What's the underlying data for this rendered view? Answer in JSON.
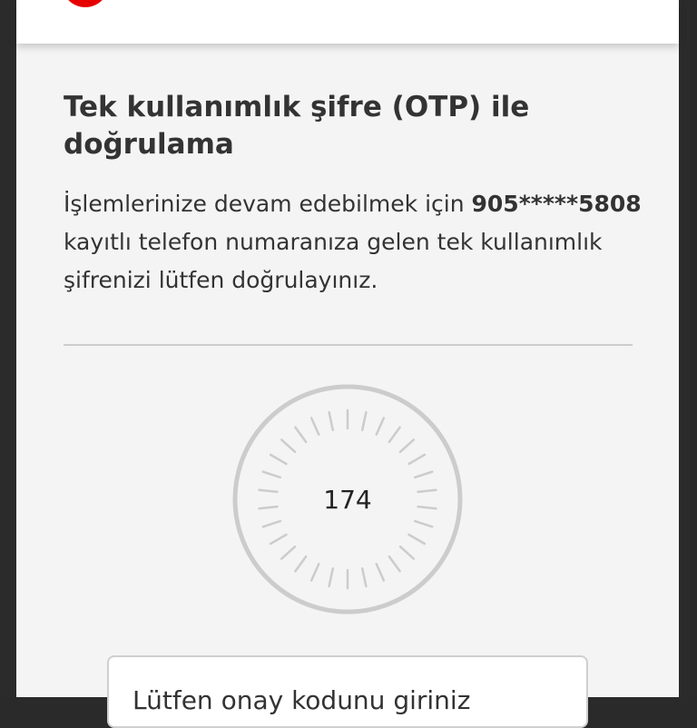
{
  "header": {
    "logo_icon": "vodafone-logo-icon",
    "brand_color": "#e60000"
  },
  "main": {
    "title": "Tek kullanımlık şifre (OTP) ile doğrulama",
    "description_prefix": "İşlemlerinize devam edebilmek için ",
    "masked_phone": "905*****5808",
    "description_suffix": " kayıtlı telefon numaranıza gelen tek kullanımlık şifrenizi lütfen doğrulayınız."
  },
  "timer": {
    "seconds_remaining": "174",
    "icon": "countdown-ring-icon"
  },
  "otp_field": {
    "placeholder": "Lütfen onay kodunu giriniz",
    "value": ""
  }
}
